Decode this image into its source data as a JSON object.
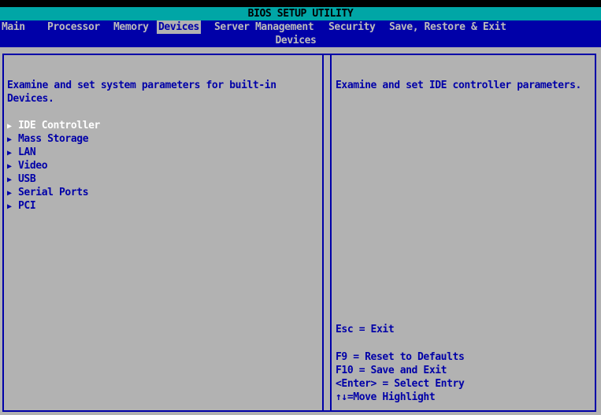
{
  "title": "BIOS SETUP UTILITY",
  "menu": [
    {
      "label": "Main",
      "selected": false
    },
    {
      "label": "Processor",
      "selected": false
    },
    {
      "label": "Memory",
      "selected": false
    },
    {
      "label": "Devices",
      "selected": true
    },
    {
      "label": "Server Management",
      "selected": false
    },
    {
      "label": "Security",
      "selected": false
    },
    {
      "label": "Save, Restore & Exit",
      "selected": false
    }
  ],
  "section_title": "Devices",
  "left_pane": {
    "description_line1": "Examine and set system parameters for built-in",
    "description_line2": "Devices.",
    "items": [
      {
        "label": "IDE Controller",
        "active": true
      },
      {
        "label": "Mass Storage",
        "active": false
      },
      {
        "label": "LAN",
        "active": false
      },
      {
        "label": "Video",
        "active": false
      },
      {
        "label": "USB",
        "active": false
      },
      {
        "label": "Serial Ports",
        "active": false
      },
      {
        "label": "PCI",
        "active": false
      }
    ],
    "submenu_arrow": "▶"
  },
  "right_pane": {
    "help_text": "Examine and set IDE controller parameters.",
    "keys": {
      "esc": "Esc = Exit",
      "f9": "F9 = Reset to Defaults",
      "f10": "F10 = Save and Exit",
      "enter": "<Enter> = Select Entry",
      "arrows": "↑↓=Move Highlight"
    }
  },
  "colors": {
    "background": "#b2b2b2",
    "title_bar": "#00a6a6",
    "menu_bar": "#0000a8",
    "text": "#0000a8",
    "highlight": "#ffffff"
  }
}
